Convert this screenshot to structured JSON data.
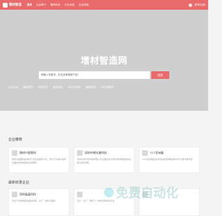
{
  "header": {
    "logo_text": "增材智造",
    "nav": [
      "首页",
      "企业简介",
      "增材科技",
      "行业动态",
      "企业定制"
    ],
    "right_text": "登录/注册"
  },
  "hero": {
    "title": "增材智造网",
    "search_placeholder": "请输入关键词，在此全局搜索产品！",
    "search_button": "搜索",
    "hot_links": [
      "企业公司",
      "增材研究",
      "材料打印",
      "激光测光",
      "3D打印材料",
      "增材应用",
      "3D打印配件"
    ]
  },
  "sections": {
    "recommend_title": "企业推荐",
    "latest_title": "最新收录企业"
  },
  "cards_row1": [
    {
      "name": "增材兴星图科",
      "desc": "增材兴星图科是增材产业综合服务平台，致力于为用户提供全面的增材制造信息和服务"
    },
    {
      "name": "深圳市增光激科技",
      "desc": "深圳市增光激科技有限公司主要业务为激光增材制造相关设备与配件销售"
    },
    {
      "name": "TCT亚洲展",
      "desc": "TCT亚洲展是亚洲领先的增材制造和3D打印技术展览会"
    }
  ],
  "cards_row2": [
    {
      "name": "深圳晶晶科技",
      "desc": "专注于增材制造设备的研发、生产、销售与服务"
    },
    {
      "name": "",
      "desc": "设计、生产、销售于一体的高新技术企业"
    },
    {
      "name": "",
      "desc": ""
    }
  ],
  "watermark": "免费自动化"
}
